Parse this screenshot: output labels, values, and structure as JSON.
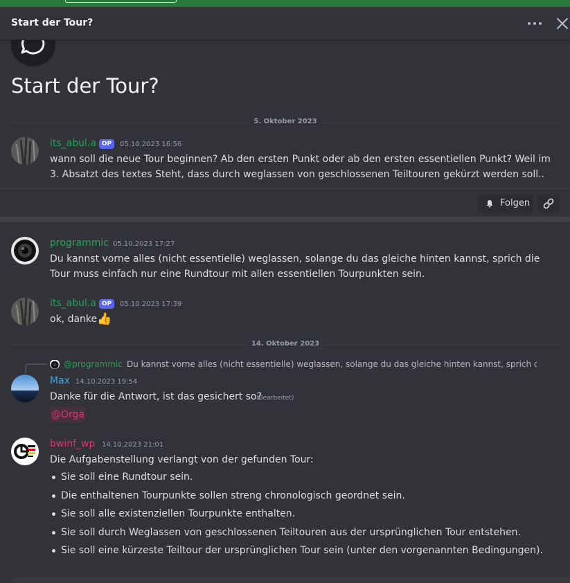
{
  "header": {
    "title": "Start der Tour?"
  },
  "thread": {
    "title": "Start der Tour?"
  },
  "dividers": [
    "5. Oktober 2023",
    "14. Oktober 2023"
  ],
  "messages": [
    {
      "user": "its_abul.a",
      "badge": "OP",
      "time": "05.10.2023 16:56",
      "lines": [
        "wann soll die neue Tour beginnen? Ab den ersten Punkt oder ab den ersten essentiellen Punkt? Weil im",
        "3. Absatzt des textes Steht, dass durch weglassen von geschlossenen Teiltouren gekürzt werden soll.."
      ]
    },
    {
      "user": "programmic",
      "time": "05.10.2023 17:27",
      "lines": [
        "Du kannst vorne alles (nicht essentielle) weglassen, solange du das gleiche hinten kannst, sprich die",
        "Tour muss einfach nur eine Rundtour mit allen essentiellen Tourpunkten sein."
      ]
    },
    {
      "user": "its_abul.a",
      "badge": "OP",
      "time": "05.10.2023 17:39",
      "text": "ok, danke",
      "emoji": "👍"
    },
    {
      "user": "Max",
      "time": "14.10.2023 19:54",
      "text": "Danke für die Antwort, ist das gesichert so?",
      "edited": "(Bearbeitet)",
      "mention": "@Orga",
      "reply": {
        "user": "@programmic",
        "text": "Du kannst vorne alles (nicht essentielle) weglassen, solange du das gleiche hinten kannst, sprich die Tour muss einfach nur eine Rundtour mit allen essentiellen Tourpunkten sein."
      }
    },
    {
      "user": "bwinf_wp",
      "time": "14.10.2023 21:01",
      "text": "Die Aufgabenstellung verlangt von der gefunden Tour:",
      "bullets": [
        "Sie soll eine Rundtour sein.",
        "Die enthaltenen Tourpunkte sollen streng chronologisch geordnet sein.",
        "Sie soll alle existenziellen Tourpunkte enthalten.",
        "Sie soll durch Weglassen von geschlossenen Teiltouren aus der ursprünglichen Tour entstehen.",
        "Sie soll eine kürzeste Teiltour der ursprünglichen Tour sein (unter den vorgenannten Bedingungen)."
      ]
    }
  ],
  "op_actions": {
    "follow_label": "Folgen"
  },
  "colors": {
    "background": "#313338",
    "username_green": "#23a559",
    "username_blue": "#3ba7e5",
    "username_pink": "#e8306d",
    "op_badge": "#5865f2",
    "mention": "#e8306d"
  },
  "icons": [
    "thread-icon",
    "more-icon",
    "close-icon",
    "bell-icon",
    "link-icon"
  ]
}
